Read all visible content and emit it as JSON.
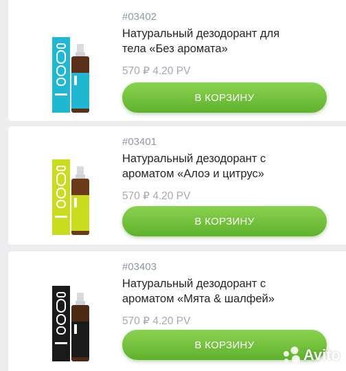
{
  "products": [
    {
      "sku": "#03402",
      "title_line1": "Натуральный дезодорант для",
      "title_line2": "тела «Без аромата»",
      "price": "570 ₽ 4.20 PV",
      "button_label": "В КОРЗИНУ",
      "accent": "#1fb7d4",
      "icon": "deodorant-bottle-blue-icon"
    },
    {
      "sku": "#03401",
      "title_line1": "Натуральный дезодорант с",
      "title_line2": "ароматом «Алоэ и цитрус»",
      "price": "570 ₽ 4.20 PV",
      "button_label": "В КОРЗИНУ",
      "accent": "#c9dd1e",
      "icon": "deodorant-bottle-lime-icon"
    },
    {
      "sku": "#03403",
      "title_line1": "Натуральный дезодорант с",
      "title_line2": "ароматом «Мята & шалфей»",
      "price": "570 ₽ 4.20 PV",
      "button_label": "В КОРЗИНУ",
      "accent": "#1a1a1a",
      "icon": "deodorant-bottle-black-icon"
    }
  ],
  "watermark": {
    "text": "Avito",
    "icon": "avito-logo-icon"
  },
  "colors": {
    "button": "#6cbf36",
    "background": "#ececef",
    "sku": "#8e97a6",
    "price": "#a4aab3"
  }
}
